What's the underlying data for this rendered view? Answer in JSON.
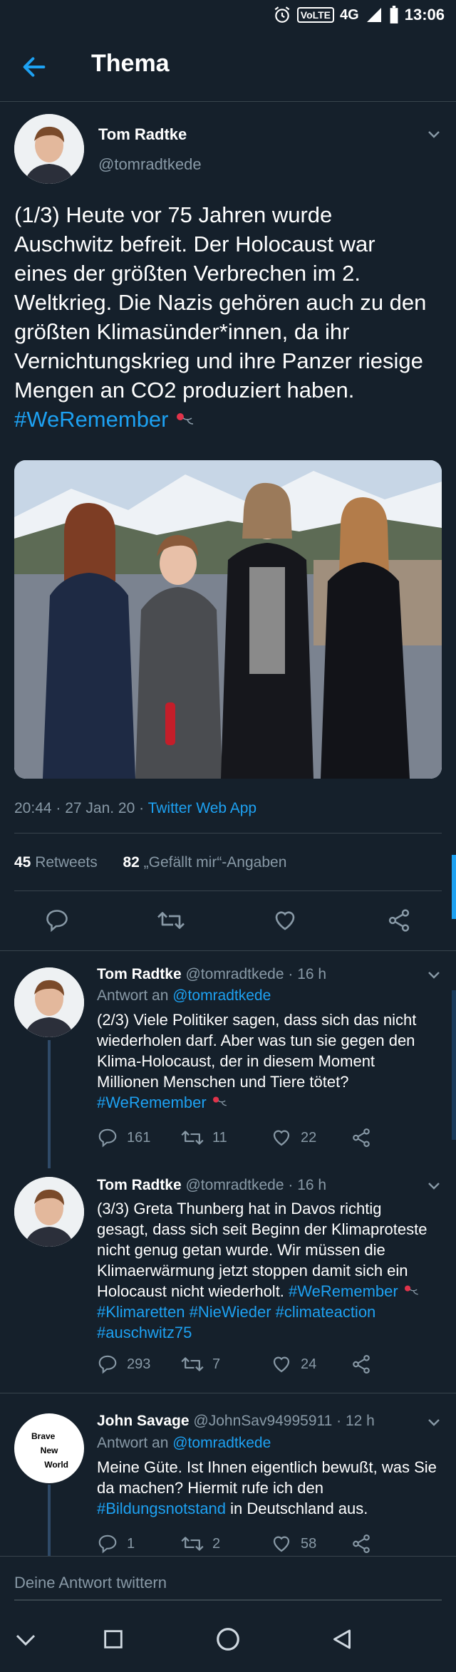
{
  "status": {
    "time": "13:06",
    "volte": "VoLTE",
    "net": "4G"
  },
  "header": {
    "title": "Thema"
  },
  "main_tweet": {
    "name": "Tom Radtke",
    "handle": "@tomradtkede",
    "text_plain": "(1/3) Heute vor 75 Jahren wurde Auschwitz befreit. Der Holocaust war eines der größten Verbrechen im 2. Weltkrieg. Die Nazis gehören auch zu den größten Klimasünder*innen, da ihr Vernichtungskrieg und ihre Panzer riesige Mengen an CO2 produziert haben.",
    "hashtag": "#WeRemember",
    "meta_time": "20:44 · 27 Jan. 20 · ",
    "meta_source": "Twitter Web App",
    "retweets_count": "45",
    "retweets_label": "Retweets",
    "likes_count": "82",
    "likes_label": "„Gefällt mir“-Angaben"
  },
  "replies": [
    {
      "name": "Tom Radtke",
      "handle": "@tomradtkede · 16 h",
      "reply_to_label": "Antwort an ",
      "reply_to": "@tomradtkede",
      "text": "(2/3) Viele Politiker sagen, dass sich das nicht wiederholen darf. Aber was tun sie gegen den Klima-Holocaust, der in diesem Moment Millionen Menschen und Tiere tötet?",
      "tags": "#WeRemember",
      "replies": "161",
      "retweets": "11",
      "likes": "22"
    },
    {
      "name": "Tom Radtke",
      "handle": "@tomradtkede · 16 h",
      "text": "(3/3) Greta Thunberg hat in Davos richtig gesagt, dass sich seit Beginn der Klimaproteste nicht genug getan wurde. Wir müssen die Klimaerwärmung jetzt stoppen damit sich ein Holocaust nicht wiederholt.",
      "tag1": "#WeRemember",
      "tags2": "#Klimaretten #NieWieder #climateaction",
      "tags3": "#auschwitz75",
      "replies": "293",
      "retweets": "7",
      "likes": "24"
    },
    {
      "name": "John Savage",
      "handle": "@JohnSav94995911 · 12 h",
      "reply_to_label": "Antwort an ",
      "reply_to": "@tomradtkede",
      "text1": "Meine Güte. Ist Ihnen eigentlich bewußt, was Sie da machen? Hiermit rufe ich den",
      "text_tag": "#Bildungsnotstand",
      "text2": " in Deutschland aus.",
      "avatar_lines": [
        "Brave",
        "New",
        "World"
      ],
      "replies": "1",
      "retweets": "2",
      "likes": "58"
    }
  ],
  "compose": {
    "placeholder": "Deine Antwort twittern"
  },
  "colors": {
    "background": "#15202b",
    "accent": "#1da1f2",
    "muted": "#8899a6",
    "divider": "#38444d"
  }
}
